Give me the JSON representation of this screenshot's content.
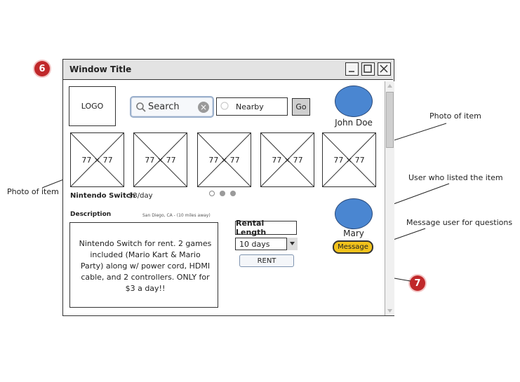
{
  "badges": {
    "window": "6",
    "rent": "7"
  },
  "window": {
    "title": "Window Title"
  },
  "header": {
    "logo": "LOGO",
    "search_text": "Search",
    "location_value": "Nearby",
    "go_label": "Go",
    "user_name": "John Doe"
  },
  "photos": [
    "77 × 77",
    "77 × 77",
    "77 × 77",
    "77 × 77",
    "77 × 77"
  ],
  "item": {
    "name": "Nintendo Switch",
    "price": "$3/day",
    "description_label": "Description",
    "location": "San Diego, CA - (10 miles away)",
    "description": "Nintendo Switch for rent. 2 games included (Mario Kart & Mario Party) along w/ power cord, HDMI cable, and 2 controllers. ONLY for $3 a day!!"
  },
  "rental": {
    "label": "Rental Length",
    "selected": "10 days",
    "rent_button": "RENT"
  },
  "lister": {
    "name": "Mary",
    "message_button": "Message"
  },
  "annotations": {
    "photo_left": "Photo of item",
    "photo_right": "Photo of item",
    "user": "User who listed the item",
    "message": "Message user for questions"
  },
  "colors": {
    "avatar": "#4a86d1",
    "message_button": "#f2c21b",
    "badge": "#c0282a"
  }
}
